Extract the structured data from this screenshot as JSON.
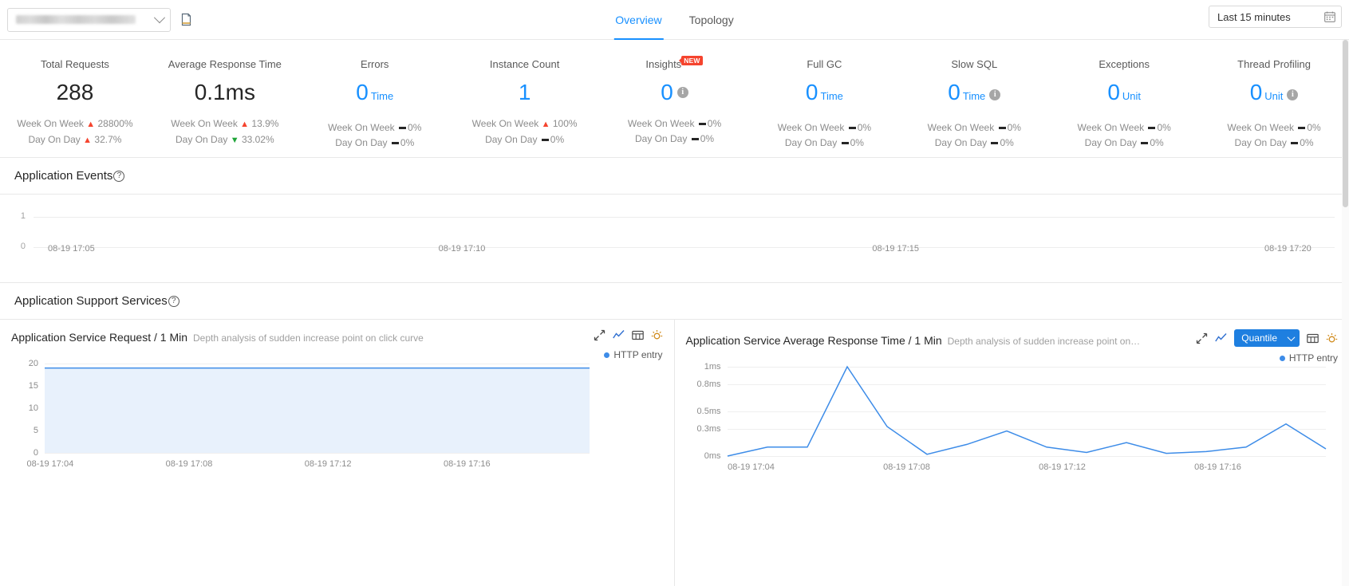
{
  "header": {
    "app_selector_value": "",
    "app_selector_placeholder": "",
    "copy_icon": "copy-icon",
    "tabs": [
      {
        "label": "Overview",
        "active": true
      },
      {
        "label": "Topology",
        "active": false
      }
    ],
    "time_range": "Last 15 minutes",
    "calendar_icon": "calendar-icon"
  },
  "kpis": [
    {
      "title": "Total Requests",
      "value": "288",
      "unit": "",
      "blue": false,
      "badge": "",
      "info": false,
      "wow_label": "Week On Week",
      "wow_dir": "up",
      "wow_value": "28800%",
      "dod_label": "Day On Day",
      "dod_dir": "up",
      "dod_value": "32.7%"
    },
    {
      "title": "Average Response Time",
      "value": "0.1ms",
      "unit": "",
      "blue": false,
      "badge": "",
      "info": false,
      "wow_label": "Week On Week",
      "wow_dir": "up",
      "wow_value": "13.9%",
      "dod_label": "Day On Day",
      "dod_dir": "down",
      "dod_value": "33.02%"
    },
    {
      "title": "Errors",
      "value": "0",
      "unit": "Time",
      "blue": true,
      "badge": "",
      "info": false,
      "wow_label": "Week On Week",
      "wow_dir": "flat",
      "wow_value": "0%",
      "dod_label": "Day On Day",
      "dod_dir": "flat",
      "dod_value": "0%"
    },
    {
      "title": "Instance Count",
      "value": "1",
      "unit": "",
      "blue": true,
      "badge": "",
      "info": false,
      "wow_label": "Week On Week",
      "wow_dir": "up",
      "wow_value": "100%",
      "dod_label": "Day On Day",
      "dod_dir": "flat",
      "dod_value": "0%"
    },
    {
      "title": "Insights",
      "value": "0",
      "unit": "",
      "blue": true,
      "badge": "NEW",
      "info": true,
      "wow_label": "Week On Week",
      "wow_dir": "flat",
      "wow_value": "0%",
      "dod_label": "Day On Day",
      "dod_dir": "flat",
      "dod_value": "0%"
    },
    {
      "title": "Full GC",
      "value": "0",
      "unit": "Time",
      "blue": true,
      "badge": "",
      "info": false,
      "wow_label": "Week On Week",
      "wow_dir": "flat",
      "wow_value": "0%",
      "dod_label": "Day On Day",
      "dod_dir": "flat",
      "dod_value": "0%"
    },
    {
      "title": "Slow SQL",
      "value": "0",
      "unit": "Time",
      "blue": true,
      "badge": "",
      "info": true,
      "wow_label": "Week On Week",
      "wow_dir": "flat",
      "wow_value": "0%",
      "dod_label": "Day On Day",
      "dod_dir": "flat",
      "dod_value": "0%"
    },
    {
      "title": "Exceptions",
      "value": "0",
      "unit": "Unit",
      "blue": true,
      "badge": "",
      "info": false,
      "wow_label": "Week On Week",
      "wow_dir": "flat",
      "wow_value": "0%",
      "dod_label": "Day On Day",
      "dod_dir": "flat",
      "dod_value": "0%"
    },
    {
      "title": "Thread Profiling",
      "value": "0",
      "unit": "Unit",
      "blue": true,
      "badge": "",
      "info": true,
      "wow_label": "Week On Week",
      "wow_dir": "flat",
      "wow_value": "0%",
      "dod_label": "Day On Day",
      "dod_dir": "flat",
      "dod_value": "0%"
    }
  ],
  "events_section": {
    "title": "Application Events",
    "help_icon": "question-circle-icon"
  },
  "support_section": {
    "title": "Application Support Services",
    "help_icon": "question-circle-icon"
  },
  "charts": {
    "request": {
      "title": "Application Service Request / 1 Min",
      "subtitle": "Depth analysis of sudden increase point on click curve",
      "legend": "HTTP entry",
      "tools": [
        "expand-icon",
        "line-chart-icon",
        "table-icon",
        "alert-icon"
      ]
    },
    "response": {
      "title": "Application Service Average Response Time / 1 Min",
      "subtitle": "Depth analysis of sudden increase point on…",
      "legend": "HTTP entry",
      "quantile_label": "Quantile",
      "tools": [
        "expand-icon",
        "line-chart-icon",
        "table-icon",
        "alert-icon"
      ]
    }
  },
  "chart_data": [
    {
      "type": "line",
      "name": "application-events",
      "title": "Application Events",
      "xlabel": "",
      "ylabel": "",
      "categories": [
        "08-19 17:05",
        "08-19 17:10",
        "08-19 17:15",
        "08-19 17:20"
      ],
      "yticks": [
        "0",
        "1"
      ],
      "ylim": [
        0,
        1
      ],
      "series": [
        {
          "name": "events",
          "values": [
            0,
            0,
            0,
            0
          ]
        }
      ],
      "grid": true,
      "legend": "none"
    },
    {
      "type": "area",
      "name": "application-service-request",
      "title": "Application Service Request / 1 Min",
      "xlabel": "",
      "ylabel": "",
      "yticks": [
        "0",
        "5",
        "10",
        "15",
        "20"
      ],
      "ylim": [
        0,
        20
      ],
      "xticks": [
        "08-19 17:04",
        "08-19 17:08",
        "08-19 17:12",
        "08-19 17:16"
      ],
      "x": [
        0,
        1,
        2,
        3,
        4,
        5,
        6,
        7,
        8,
        9,
        10,
        11,
        12,
        13,
        14,
        15
      ],
      "series": [
        {
          "name": "HTTP entry",
          "values": [
            19,
            19,
            19,
            19,
            19,
            19,
            19,
            19,
            19,
            19,
            19,
            19,
            19,
            19,
            19,
            19
          ]
        }
      ],
      "grid": true,
      "legend": "top-right",
      "color": "#3d8ce8",
      "fill": "#e8f1fc"
    },
    {
      "type": "line",
      "name": "application-service-average-response-time",
      "title": "Application Service Average Response Time / 1 Min",
      "xlabel": "",
      "ylabel": "",
      "yticks": [
        "0ms",
        "0.3ms",
        "0.5ms",
        "0.8ms",
        "1ms"
      ],
      "ylim": [
        0,
        1
      ],
      "xticks": [
        "08-19 17:04",
        "08-19 17:08",
        "08-19 17:12",
        "08-19 17:16"
      ],
      "x": [
        0,
        1,
        2,
        3,
        4,
        5,
        6,
        7,
        8,
        9,
        10,
        11,
        12,
        13,
        14,
        15
      ],
      "series": [
        {
          "name": "HTTP entry",
          "values": [
            0.0,
            0.1,
            0.1,
            1.0,
            0.33,
            0.02,
            0.13,
            0.28,
            0.1,
            0.04,
            0.15,
            0.03,
            0.05,
            0.1,
            0.36,
            0.08
          ]
        }
      ],
      "grid": true,
      "legend": "top-right",
      "color": "#3d8ce8"
    }
  ]
}
